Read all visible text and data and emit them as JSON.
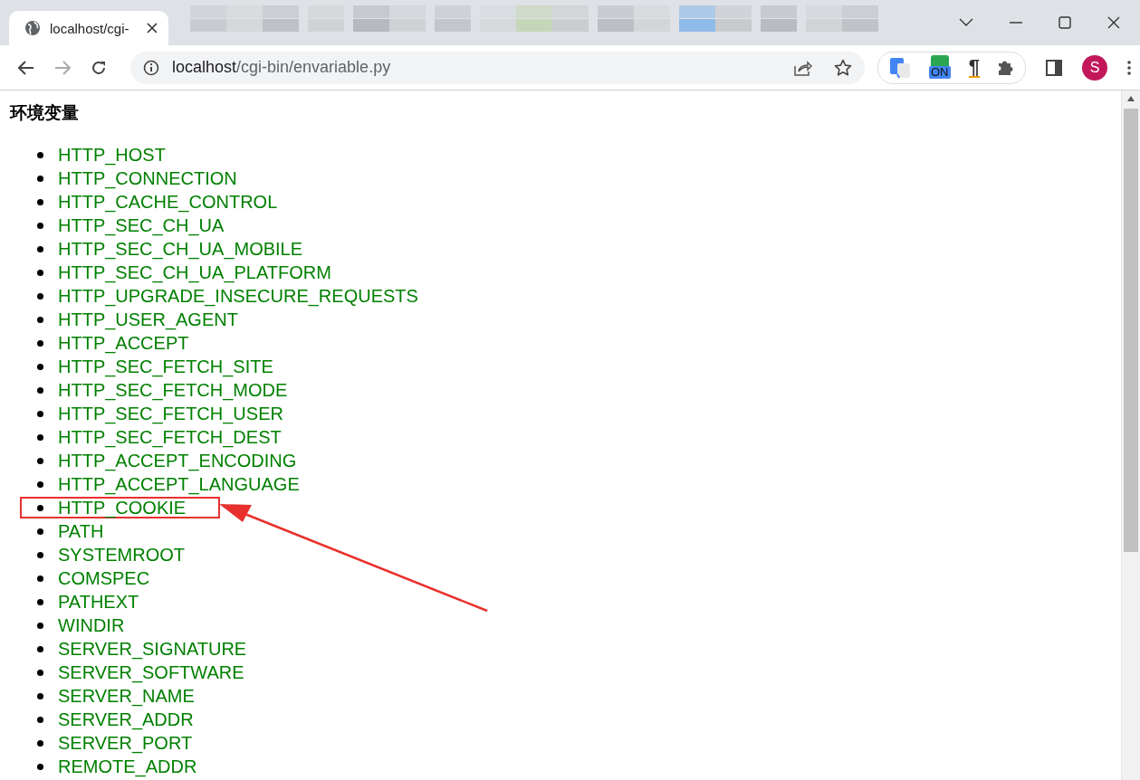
{
  "tab": {
    "title": "localhost/cgi-",
    "selected": true
  },
  "address": {
    "host": "localhost",
    "path": "/cgi-bin/envariable.py"
  },
  "extensions": {
    "badge": "ON",
    "pilcrow": "¶"
  },
  "profile": {
    "initial": "S"
  },
  "page": {
    "heading": "环境变量",
    "items": [
      {
        "text": "HTTP_HOST",
        "highlighted": false
      },
      {
        "text": "HTTP_CONNECTION",
        "highlighted": false
      },
      {
        "text": "HTTP_CACHE_CONTROL",
        "highlighted": false
      },
      {
        "text": "HTTP_SEC_CH_UA",
        "highlighted": false
      },
      {
        "text": "HTTP_SEC_CH_UA_MOBILE",
        "highlighted": false
      },
      {
        "text": "HTTP_SEC_CH_UA_PLATFORM",
        "highlighted": false
      },
      {
        "text": "HTTP_UPGRADE_INSECURE_REQUESTS",
        "highlighted": false
      },
      {
        "text": "HTTP_USER_AGENT",
        "highlighted": false
      },
      {
        "text": "HTTP_ACCEPT",
        "highlighted": false
      },
      {
        "text": "HTTP_SEC_FETCH_SITE",
        "highlighted": false
      },
      {
        "text": "HTTP_SEC_FETCH_MODE",
        "highlighted": false
      },
      {
        "text": "HTTP_SEC_FETCH_USER",
        "highlighted": false
      },
      {
        "text": "HTTP_SEC_FETCH_DEST",
        "highlighted": false
      },
      {
        "text": "HTTP_ACCEPT_ENCODING",
        "highlighted": false
      },
      {
        "text": "HTTP_ACCEPT_LANGUAGE",
        "highlighted": false
      },
      {
        "text": "HTTP_COOKIE",
        "highlighted": true
      },
      {
        "text": "PATH",
        "highlighted": false
      },
      {
        "text": "SYSTEMROOT",
        "highlighted": false
      },
      {
        "text": "COMSPEC",
        "highlighted": false
      },
      {
        "text": "PATHEXT",
        "highlighted": false
      },
      {
        "text": "WINDIR",
        "highlighted": false
      },
      {
        "text": "SERVER_SIGNATURE",
        "highlighted": false
      },
      {
        "text": "SERVER_SOFTWARE",
        "highlighted": false
      },
      {
        "text": "SERVER_NAME",
        "highlighted": false
      },
      {
        "text": "SERVER_ADDR",
        "highlighted": false
      },
      {
        "text": "SERVER_PORT",
        "highlighted": false
      },
      {
        "text": "REMOTE_ADDR",
        "highlighted": false
      }
    ]
  }
}
